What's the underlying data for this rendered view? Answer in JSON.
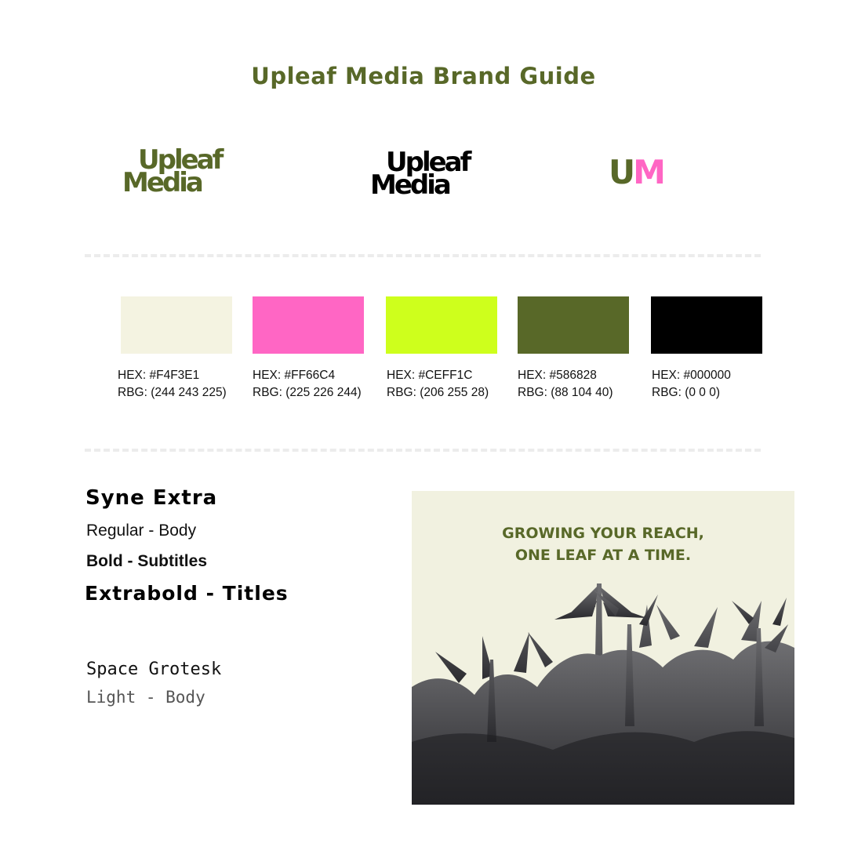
{
  "title": "Upleaf Media Brand Guide",
  "logos": {
    "wordmark_line1": "Upleaf",
    "wordmark_line2": "Media",
    "monogram_u": "U",
    "monogram_m": "M"
  },
  "colors": {
    "primary_green": "#586828",
    "accent_pink": "#FF66C4"
  },
  "swatches": [
    {
      "color": "#F4F3E1",
      "hex": "HEX: #F4F3E1",
      "rgb": "RBG: (244 243 225)"
    },
    {
      "color": "#FF66C4",
      "hex": "HEX: #FF66C4",
      "rgb": "RBG: (225 226 244)"
    },
    {
      "color": "#CEFF1C",
      "hex": "HEX: #CEFF1C",
      "rgb": "RBG: (206 255 28)"
    },
    {
      "color": "#586828",
      "hex": "HEX: #586828",
      "rgb": "RBG: (88 104 40)"
    },
    {
      "color": "#000000",
      "hex": "HEX: #000000",
      "rgb": "RBG: (0 0 0)"
    }
  ],
  "typography": {
    "primary_name": "Syne Extra",
    "regular": "Regular - Body",
    "bold": "Bold - Subtitles",
    "extrabold": "Extrabold - Titles",
    "secondary_name": "Space Grotesk",
    "light": "Light - Body"
  },
  "poster": {
    "line1": "GROWING YOUR REACH,",
    "line2": "ONE LEAF AT A TIME."
  }
}
